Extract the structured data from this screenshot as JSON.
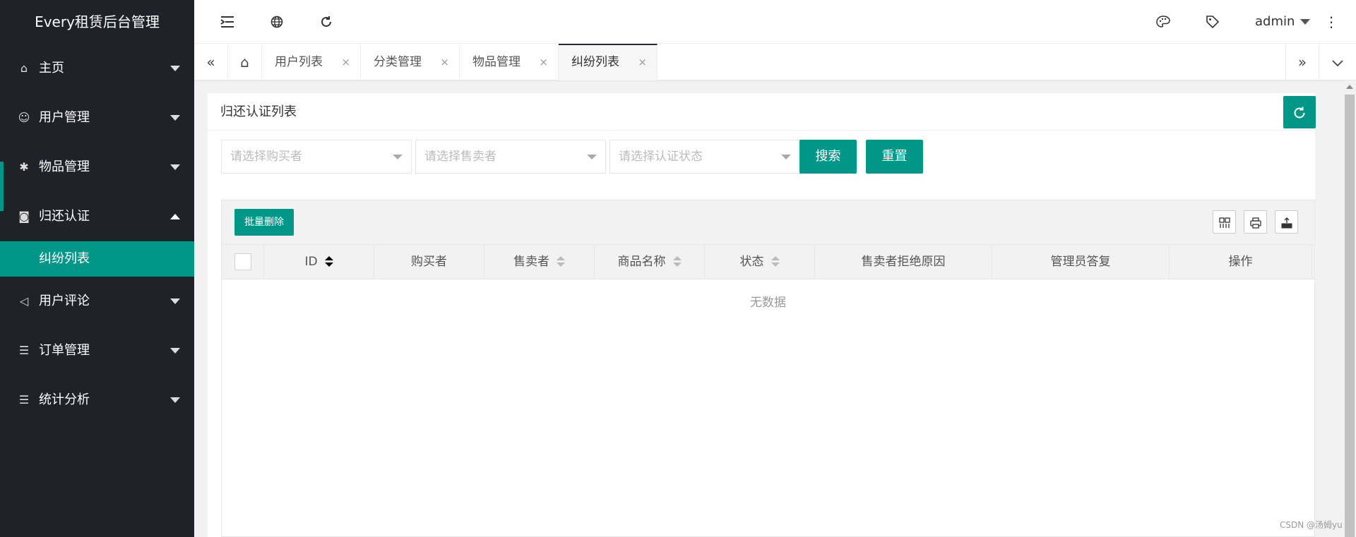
{
  "app": {
    "title": "Every租赁后台管理"
  },
  "sidebar": {
    "items": [
      {
        "label": "主页",
        "icon": "home-icon",
        "glyph": "⌂"
      },
      {
        "label": "用户管理",
        "icon": "user-icon",
        "glyph": "☺"
      },
      {
        "label": "物品管理",
        "icon": "goods-icon",
        "glyph": "✱"
      },
      {
        "label": "归还认证",
        "icon": "camera-icon",
        "glyph": "◙"
      },
      {
        "label": "用户评论",
        "icon": "speaker-icon",
        "glyph": "◁"
      },
      {
        "label": "订单管理",
        "icon": "list-icon",
        "glyph": "☰"
      },
      {
        "label": "统计分析",
        "icon": "list-icon",
        "glyph": "☰"
      }
    ],
    "sub_item": {
      "label": "纠纷列表"
    }
  },
  "header": {
    "user": "admin",
    "icons": [
      "menu-toggle-icon",
      "globe-icon",
      "refresh-icon",
      "palette-icon",
      "tag-icon",
      "more-icon"
    ]
  },
  "tabs": {
    "items": [
      {
        "label": "用户列表"
      },
      {
        "label": "分类管理"
      },
      {
        "label": "物品管理"
      },
      {
        "label": "纠纷列表",
        "active": true
      }
    ],
    "close_glyph": "×"
  },
  "page": {
    "title": "归还认证列表",
    "filters": {
      "buyer_placeholder": "请选择购买者",
      "seller_placeholder": "请选择售卖者",
      "status_placeholder": "请选择认证状态"
    },
    "search_label": "搜索",
    "reset_label": "重置",
    "batch_delete_label": "批量删除",
    "table": {
      "columns": [
        "ID",
        "购买者",
        "售卖者",
        "商品名称",
        "状态",
        "售卖者拒绝原因",
        "管理员答复",
        "操作"
      ],
      "empty_text": "无数据"
    }
  },
  "watermark": "CSDN @汤姆yu",
  "colors": {
    "accent": "#009688",
    "sidebar_bg": "#20222a"
  }
}
